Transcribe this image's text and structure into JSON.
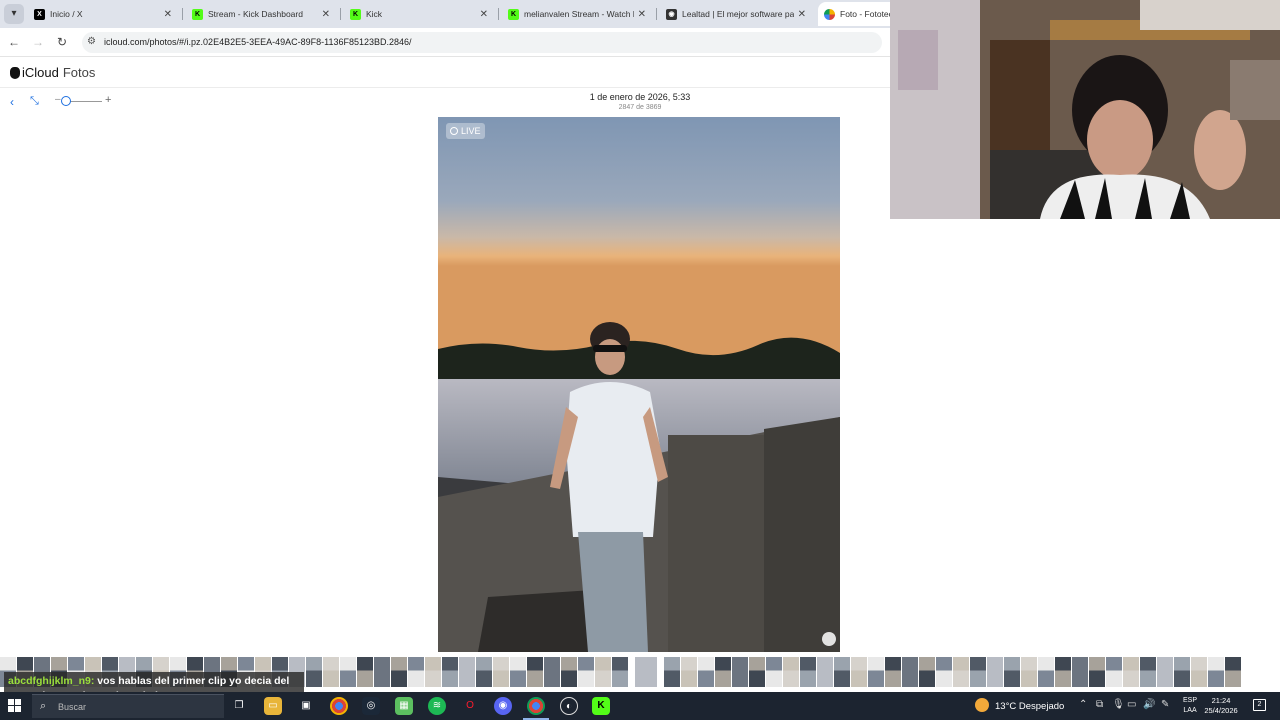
{
  "browser": {
    "tabs": [
      {
        "label": "Inicio / X",
        "icon": "x-icon",
        "active": false
      },
      {
        "label": "Stream - Kick Dashboard",
        "icon": "kick-icon",
        "active": false
      },
      {
        "label": "Kick",
        "icon": "kick-icon",
        "active": false
      },
      {
        "label": "melianvalen Stream - Watch Live",
        "icon": "kick-icon",
        "active": false
      },
      {
        "label": "Lealtad | El mejor software para",
        "icon": "lealtad-icon",
        "active": false
      },
      {
        "label": "Foto - Fototeca",
        "icon": "icloud-icon",
        "active": true
      }
    ],
    "url": "icloud.com/photos/#/i.pz.02E4B2E5-3EEA-49AC-89F8-1136F85123BD.2846/"
  },
  "icloud": {
    "brand": "iCloud",
    "section": "Fotos"
  },
  "photo_viewer": {
    "date": "1 de enero de 2026, 5:33",
    "count": "2847 de 3869",
    "live_label": "LIVE",
    "zoom_level": 0.1
  },
  "chat": {
    "username": "abcdfghijklm_n9:",
    "message": " vos hablas del primer clip yo decia del segundo cuando estaba más joven"
  },
  "taskbar": {
    "search_placeholder": "Buscar",
    "weather": "13°C  Despejado",
    "lang_line1": "ESP",
    "lang_line2": "LAA",
    "time": "21:24",
    "date": "25/4/2026",
    "notification_count": "2"
  },
  "colors": {
    "accent": "#1d6fe0",
    "chat_username": "#9bdf3c",
    "taskbar": "#1c2430"
  }
}
